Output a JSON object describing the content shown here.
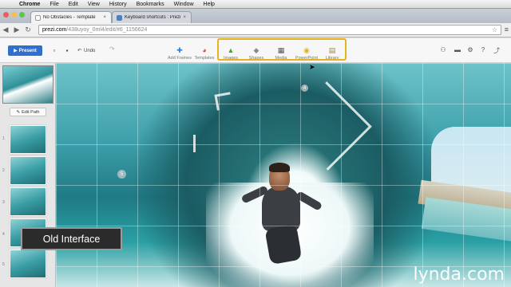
{
  "menubar": {
    "app": "Chrome",
    "items": [
      "File",
      "Edit",
      "View",
      "History",
      "Bookmarks",
      "Window",
      "Help"
    ]
  },
  "tabs": [
    {
      "title": "No Obstacles - Template",
      "active": true
    },
    {
      "title": "Keyboard shortcuts : Prezi",
      "active": false
    }
  ],
  "address": {
    "host": "prezi.com",
    "path": "/438uyoy_0ml4/edit/#6_1156624"
  },
  "toolbar": {
    "present_label": "Present",
    "undo_label": "Undo",
    "tools": [
      {
        "label": "Add Frames",
        "icon": "add-frames-icon"
      },
      {
        "label": "Templates",
        "icon": "templates-icon"
      },
      {
        "label": "Images",
        "icon": "images-icon"
      },
      {
        "label": "Shapes",
        "icon": "shapes-icon"
      },
      {
        "label": "Media",
        "icon": "media-icon"
      },
      {
        "label": "PowerPoint",
        "icon": "powerpoint-icon"
      },
      {
        "label": "Library",
        "icon": "library-icon"
      }
    ]
  },
  "sidebar": {
    "edit_path_label": "Edit Path",
    "thumb_numbers": [
      "1",
      "2",
      "3",
      "4",
      "5"
    ]
  },
  "canvas": {
    "step_badge": "5",
    "path_badge": "4",
    "watermark": "lynda.com"
  },
  "overlay": {
    "label": "Old Interface"
  },
  "colors": {
    "present_button": "#2f6fcf",
    "highlight_border": "#e6b41d",
    "overlay_bg": "#2b2b2b"
  }
}
